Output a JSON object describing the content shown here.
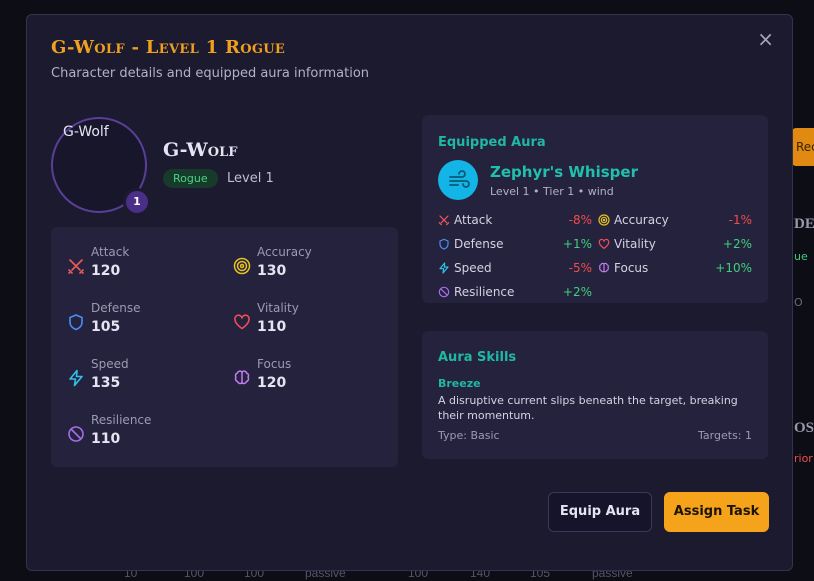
{
  "background": {
    "fragment_button": "Recrui",
    "title_1": "DEC",
    "small_1": "ue",
    "small_2": "O",
    "title_2": "OS",
    "small_3": "rior",
    "row_values": [
      "10",
      "100",
      "100",
      "passive",
      "100",
      "140",
      "105",
      "passive"
    ]
  },
  "modal": {
    "title": "G-Wolf - Level 1 Rogue",
    "subtitle": "Character details and equipped aura information",
    "close_label": "×"
  },
  "character": {
    "avatar_alt": "G-Wolf",
    "level_badge": "1",
    "name": "G-Wolf",
    "class": "Rogue",
    "level": "Level 1"
  },
  "stats": [
    {
      "label": "Attack",
      "value": "120",
      "icon": "swords-icon"
    },
    {
      "label": "Accuracy",
      "value": "130",
      "icon": "target-icon"
    },
    {
      "label": "Defense",
      "value": "105",
      "icon": "shield-icon"
    },
    {
      "label": "Vitality",
      "value": "110",
      "icon": "heart-icon"
    },
    {
      "label": "Speed",
      "value": "135",
      "icon": "lightning-icon"
    },
    {
      "label": "Focus",
      "value": "120",
      "icon": "brain-icon"
    },
    {
      "label": "Resilience",
      "value": "110",
      "icon": "ban-icon"
    }
  ],
  "aura": {
    "header": "Equipped Aura",
    "name": "Zephyr's Whisper",
    "meta": "Level 1 • Tier 1 • wind",
    "icon": "wind-icon",
    "modifiers": [
      {
        "label": "Attack",
        "value": "-8%",
        "sign": "neg",
        "icon": "swords-icon"
      },
      {
        "label": "Accuracy",
        "value": "-1%",
        "sign": "neg",
        "icon": "target-icon"
      },
      {
        "label": "Defense",
        "value": "+1%",
        "sign": "pos",
        "icon": "shield-icon"
      },
      {
        "label": "Vitality",
        "value": "+2%",
        "sign": "pos",
        "icon": "heart-icon"
      },
      {
        "label": "Speed",
        "value": "-5%",
        "sign": "neg",
        "icon": "lightning-icon"
      },
      {
        "label": "Focus",
        "value": "+10%",
        "sign": "pos",
        "icon": "brain-icon"
      },
      {
        "label": "Resilience",
        "value": "+2%",
        "sign": "pos",
        "icon": "ban-icon"
      }
    ]
  },
  "skills": {
    "header": "Aura Skills",
    "items": [
      {
        "name": "Breeze",
        "description": "A disruptive current slips beneath the target, breaking their momentum.",
        "type": "Type: Basic",
        "targets": "Targets: 1"
      }
    ]
  },
  "buttons": {
    "equip": "Equip Aura",
    "assign": "Assign Task"
  },
  "colors": {
    "accent_orange": "#f5a31a",
    "teal": "#1fb8a4",
    "positive": "#3dd17a",
    "negative": "#ef4d4d",
    "panel": "#25223d"
  }
}
